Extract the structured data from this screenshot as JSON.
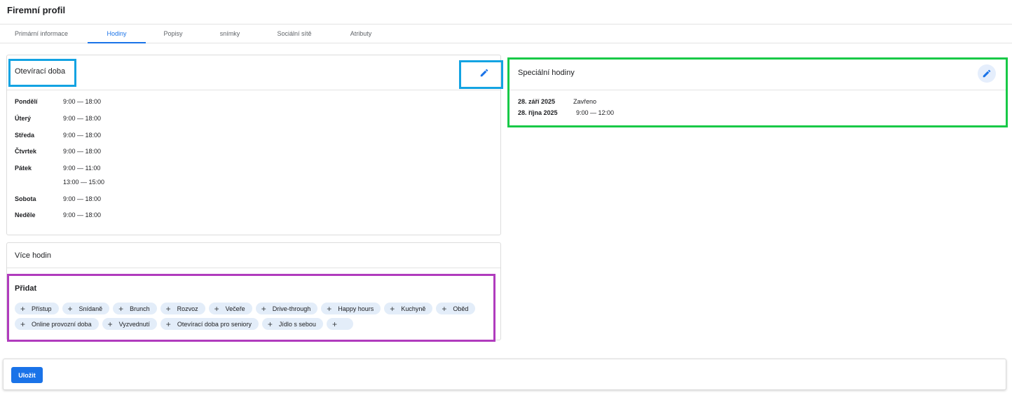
{
  "page": {
    "title": "Firemní profil"
  },
  "tabs": [
    {
      "label": "Primární informace"
    },
    {
      "label": "Hodiny"
    },
    {
      "label": "Popisy"
    },
    {
      "label": "snímky"
    },
    {
      "label": "Sociální sítě"
    },
    {
      "label": "Atributy"
    }
  ],
  "opening_hours": {
    "title": "Otevírací doba",
    "edit_icon": "pencil-icon",
    "days": [
      {
        "day": "Pondělí",
        "times": [
          "9:00 — 18:00"
        ]
      },
      {
        "day": "Úterý",
        "times": [
          "9:00 — 18:00"
        ]
      },
      {
        "day": "Středa",
        "times": [
          "9:00 — 18:00"
        ]
      },
      {
        "day": "Čtvrtek",
        "times": [
          "9:00 — 18:00"
        ]
      },
      {
        "day": "Pátek",
        "times": [
          "9:00 — 11:00",
          "13:00 — 15:00"
        ]
      },
      {
        "day": "Sobota",
        "times": [
          "9:00 — 18:00"
        ]
      },
      {
        "day": "Neděle",
        "times": [
          "9:00 — 18:00"
        ]
      }
    ]
  },
  "special_hours": {
    "title": "Speciální hodiny",
    "edit_icon": "pencil-icon",
    "rows": [
      {
        "date": "28. září 2025",
        "value": "Zavřeno"
      },
      {
        "date": "28. října 2025",
        "value": "9:00 — 12:00"
      }
    ]
  },
  "more_hours": {
    "title": "Více hodin",
    "add_label": "Přidat",
    "chips": [
      "Přístup",
      "Snídaně",
      "Brunch",
      "Rozvoz",
      "Večeře",
      "Drive-through",
      "Happy hours",
      "Kuchyně",
      "Oběd",
      "Online provozní doba",
      "Vyzvednutí",
      "Otevírací doba pro seniory",
      "Jídlo s sebou",
      ""
    ]
  },
  "footer": {
    "save_label": "Uložit"
  },
  "colors": {
    "accent": "#1a73e8",
    "chip_bg": "#e3edf9",
    "highlight_cyan": "#13a3e2",
    "highlight_green": "#18c947",
    "highlight_purple": "#b03bbd"
  }
}
